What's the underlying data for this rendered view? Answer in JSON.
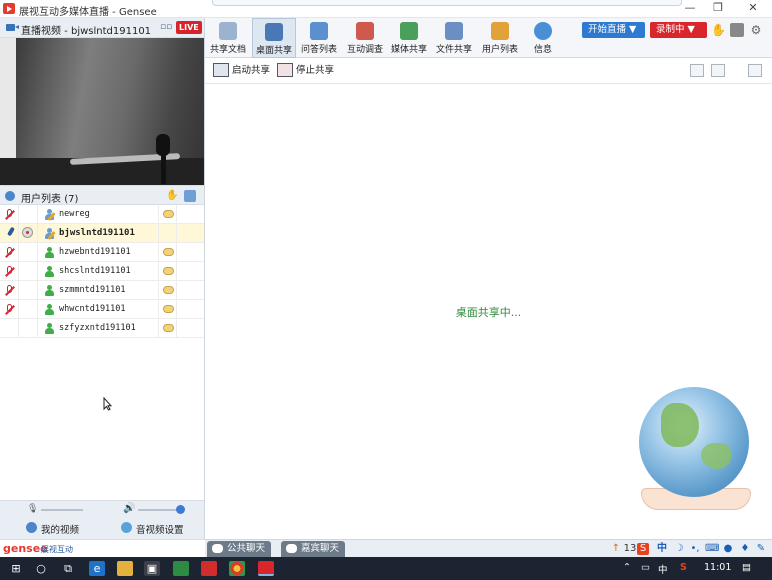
{
  "window": {
    "title": "展视互动多媒体直播 - Gensee",
    "controls": [
      "—",
      "❐",
      "✕"
    ]
  },
  "video_panel": {
    "title": "直播视频 - bjwslntd191101",
    "live_badge": "LIVE"
  },
  "user_list": {
    "title": "用户列表",
    "count": "(7)",
    "users": [
      {
        "name": "newreg",
        "muted": true,
        "role": "presenter",
        "selected": false
      },
      {
        "name": "bjwslntd191101",
        "muted": false,
        "role": "host",
        "selected": true
      },
      {
        "name": "hzwebntd191101",
        "muted": true,
        "role": "attendee",
        "selected": false
      },
      {
        "name": "shcslntd191101",
        "muted": true,
        "role": "attendee",
        "selected": false
      },
      {
        "name": "szmmntd191101",
        "muted": true,
        "role": "attendee",
        "selected": false
      },
      {
        "name": "whwcntd191101",
        "muted": true,
        "role": "attendee",
        "selected": false
      },
      {
        "name": "szfyzxntd191101",
        "muted": false,
        "role": "attendee",
        "selected": false
      }
    ]
  },
  "left_footer": {
    "my_video": "我的视频",
    "av_settings": "音视频设置"
  },
  "brand": {
    "logo": "gensee",
    "tagline": "展视互动"
  },
  "toolbar": {
    "buttons": [
      {
        "label": "共享文档",
        "icon": "document-icon",
        "color": "#9bb3cf"
      },
      {
        "label": "桌面共享",
        "icon": "desktop-share-icon",
        "color": "#4a78b6",
        "active": true
      },
      {
        "label": "问答列表",
        "icon": "qa-icon",
        "color": "#5b8fcf"
      },
      {
        "label": "互动调查",
        "icon": "survey-icon",
        "color": "#d0594e"
      },
      {
        "label": "媒体共享",
        "icon": "media-share-icon",
        "color": "#4aa05a"
      },
      {
        "label": "文件共享",
        "icon": "file-share-icon",
        "color": "#6b8fc3"
      },
      {
        "label": "用户列表",
        "icon": "user-list-icon",
        "color": "#e2a23a"
      },
      {
        "label": "信息",
        "icon": "info-icon",
        "color": "#4a8fd6"
      }
    ],
    "start_live": "开始直播 ▼",
    "recording": "录制中 ▼",
    "accent_blue": "#2e7ad1",
    "accent_red": "#d8262c"
  },
  "share_bar": {
    "start": "启动共享",
    "stop": "停止共享"
  },
  "main": {
    "status": "桌面共享中..."
  },
  "chat_tabs": {
    "public": "公共聊天",
    "guest": "嘉宾聊天"
  },
  "tray_count": "13",
  "ime": "中",
  "taskbar": {
    "lang": "中",
    "time": "11:01"
  }
}
